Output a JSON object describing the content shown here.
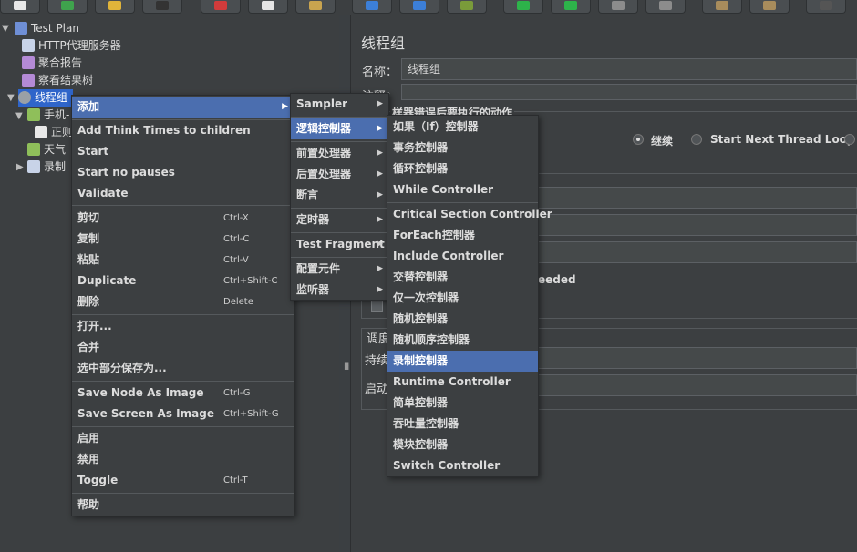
{
  "colors": {
    "accent": "#4b6eaf",
    "selection": "#2f65ca",
    "background": "#3c3f41"
  },
  "toolbar": {
    "icons": [
      "new-icon",
      "templates-icon",
      "open-icon",
      "save-icon",
      "cut-icon",
      "copy-icon",
      "paste-icon",
      "expand-icon",
      "collapse-icon",
      "toggle-icon",
      "start-icon",
      "start-no-pauses-icon",
      "stop-icon",
      "shutdown-icon",
      "clear-icon",
      "clear-all-icon",
      "search-icon"
    ]
  },
  "tree": {
    "items": [
      {
        "label": "Test Plan",
        "icon": "test-plan-icon"
      },
      {
        "label": "HTTP代理服务器",
        "icon": "proxy-icon"
      },
      {
        "label": "聚合报告",
        "icon": "report-icon"
      },
      {
        "label": "察看结果树",
        "icon": "results-tree-icon"
      },
      {
        "label": "线程组",
        "icon": "gear-icon"
      },
      {
        "label": "手机-",
        "icon": "sampler-icon"
      },
      {
        "label": "正则",
        "icon": "extractor-icon"
      },
      {
        "label": "天气",
        "icon": "sampler-icon"
      },
      {
        "label": "录制",
        "icon": "controller-icon"
      }
    ]
  },
  "panel": {
    "title": "线程组",
    "name_label": "名称：",
    "name_value": "线程组",
    "comment_label": "注释：",
    "error_action_label": "样器错误后要执行的动作",
    "radio_continue": "继续",
    "radio_next_loop": "Start Next Thread Loop",
    "fragment_text": "eeded",
    "scheduler_label": "调度",
    "duration_label": "持续",
    "startup_label": "启动"
  },
  "context_menu": {
    "items": [
      {
        "label": "添加",
        "submenu": true,
        "highlight": true
      },
      {
        "label": "Add Think Times to children"
      },
      {
        "label": "Start"
      },
      {
        "label": "Start no pauses"
      },
      {
        "label": "Validate"
      },
      {
        "label": "剪切",
        "shortcut": "Ctrl-X"
      },
      {
        "label": "复制",
        "shortcut": "Ctrl-C"
      },
      {
        "label": "粘贴",
        "shortcut": "Ctrl-V"
      },
      {
        "label": "Duplicate",
        "shortcut": "Ctrl+Shift-C"
      },
      {
        "label": "删除",
        "shortcut": "Delete"
      },
      {
        "label": "打开..."
      },
      {
        "label": "合并"
      },
      {
        "label": "选中部分保存为..."
      },
      {
        "label": "Save Node As Image",
        "shortcut": "Ctrl-G"
      },
      {
        "label": "Save Screen As Image",
        "shortcut": "Ctrl+Shift-G"
      },
      {
        "label": "启用"
      },
      {
        "label": "禁用"
      },
      {
        "label": "Toggle",
        "shortcut": "Ctrl-T"
      },
      {
        "label": "帮助"
      }
    ]
  },
  "add_menu": {
    "items": [
      {
        "label": "Sampler",
        "submenu": true
      },
      {
        "label": "逻辑控制器",
        "submenu": true,
        "highlight": true
      },
      {
        "label": "前置处理器",
        "submenu": true
      },
      {
        "label": "后置处理器",
        "submenu": true
      },
      {
        "label": "断言",
        "submenu": true
      },
      {
        "label": "定时器",
        "submenu": true
      },
      {
        "label": "Test Fragment",
        "submenu": true
      },
      {
        "label": "配置元件",
        "submenu": true
      },
      {
        "label": "监听器",
        "submenu": true
      }
    ]
  },
  "logic_menu": {
    "items": [
      {
        "label": "如果（If）控制器"
      },
      {
        "label": "事务控制器"
      },
      {
        "label": "循环控制器"
      },
      {
        "label": "While Controller"
      },
      {
        "label": "Critical Section Controller"
      },
      {
        "label": "ForEach控制器"
      },
      {
        "label": "Include Controller"
      },
      {
        "label": "交替控制器"
      },
      {
        "label": "仅一次控制器"
      },
      {
        "label": "随机控制器"
      },
      {
        "label": "随机顺序控制器"
      },
      {
        "label": "录制控制器",
        "highlight": true
      },
      {
        "label": "Runtime Controller"
      },
      {
        "label": "简单控制器"
      },
      {
        "label": "吞吐量控制器"
      },
      {
        "label": "模块控制器"
      },
      {
        "label": "Switch Controller"
      }
    ]
  }
}
